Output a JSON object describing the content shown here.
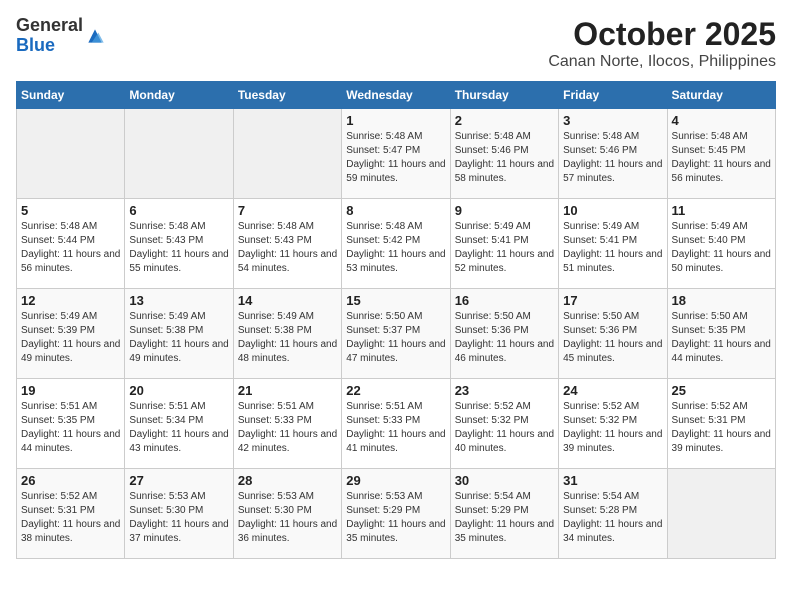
{
  "header": {
    "logo_general": "General",
    "logo_blue": "Blue",
    "month": "October 2025",
    "location": "Canan Norte, Ilocos, Philippines"
  },
  "days_of_week": [
    "Sunday",
    "Monday",
    "Tuesday",
    "Wednesday",
    "Thursday",
    "Friday",
    "Saturday"
  ],
  "weeks": [
    [
      {
        "day": "",
        "sunrise": "",
        "sunset": "",
        "daylight": "",
        "empty": true
      },
      {
        "day": "",
        "sunrise": "",
        "sunset": "",
        "daylight": "",
        "empty": true
      },
      {
        "day": "",
        "sunrise": "",
        "sunset": "",
        "daylight": "",
        "empty": true
      },
      {
        "day": "1",
        "sunrise": "Sunrise: 5:48 AM",
        "sunset": "Sunset: 5:47 PM",
        "daylight": "Daylight: 11 hours and 59 minutes."
      },
      {
        "day": "2",
        "sunrise": "Sunrise: 5:48 AM",
        "sunset": "Sunset: 5:46 PM",
        "daylight": "Daylight: 11 hours and 58 minutes."
      },
      {
        "day": "3",
        "sunrise": "Sunrise: 5:48 AM",
        "sunset": "Sunset: 5:46 PM",
        "daylight": "Daylight: 11 hours and 57 minutes."
      },
      {
        "day": "4",
        "sunrise": "Sunrise: 5:48 AM",
        "sunset": "Sunset: 5:45 PM",
        "daylight": "Daylight: 11 hours and 56 minutes."
      }
    ],
    [
      {
        "day": "5",
        "sunrise": "Sunrise: 5:48 AM",
        "sunset": "Sunset: 5:44 PM",
        "daylight": "Daylight: 11 hours and 56 minutes."
      },
      {
        "day": "6",
        "sunrise": "Sunrise: 5:48 AM",
        "sunset": "Sunset: 5:43 PM",
        "daylight": "Daylight: 11 hours and 55 minutes."
      },
      {
        "day": "7",
        "sunrise": "Sunrise: 5:48 AM",
        "sunset": "Sunset: 5:43 PM",
        "daylight": "Daylight: 11 hours and 54 minutes."
      },
      {
        "day": "8",
        "sunrise": "Sunrise: 5:48 AM",
        "sunset": "Sunset: 5:42 PM",
        "daylight": "Daylight: 11 hours and 53 minutes."
      },
      {
        "day": "9",
        "sunrise": "Sunrise: 5:49 AM",
        "sunset": "Sunset: 5:41 PM",
        "daylight": "Daylight: 11 hours and 52 minutes."
      },
      {
        "day": "10",
        "sunrise": "Sunrise: 5:49 AM",
        "sunset": "Sunset: 5:41 PM",
        "daylight": "Daylight: 11 hours and 51 minutes."
      },
      {
        "day": "11",
        "sunrise": "Sunrise: 5:49 AM",
        "sunset": "Sunset: 5:40 PM",
        "daylight": "Daylight: 11 hours and 50 minutes."
      }
    ],
    [
      {
        "day": "12",
        "sunrise": "Sunrise: 5:49 AM",
        "sunset": "Sunset: 5:39 PM",
        "daylight": "Daylight: 11 hours and 49 minutes."
      },
      {
        "day": "13",
        "sunrise": "Sunrise: 5:49 AM",
        "sunset": "Sunset: 5:38 PM",
        "daylight": "Daylight: 11 hours and 49 minutes."
      },
      {
        "day": "14",
        "sunrise": "Sunrise: 5:49 AM",
        "sunset": "Sunset: 5:38 PM",
        "daylight": "Daylight: 11 hours and 48 minutes."
      },
      {
        "day": "15",
        "sunrise": "Sunrise: 5:50 AM",
        "sunset": "Sunset: 5:37 PM",
        "daylight": "Daylight: 11 hours and 47 minutes."
      },
      {
        "day": "16",
        "sunrise": "Sunrise: 5:50 AM",
        "sunset": "Sunset: 5:36 PM",
        "daylight": "Daylight: 11 hours and 46 minutes."
      },
      {
        "day": "17",
        "sunrise": "Sunrise: 5:50 AM",
        "sunset": "Sunset: 5:36 PM",
        "daylight": "Daylight: 11 hours and 45 minutes."
      },
      {
        "day": "18",
        "sunrise": "Sunrise: 5:50 AM",
        "sunset": "Sunset: 5:35 PM",
        "daylight": "Daylight: 11 hours and 44 minutes."
      }
    ],
    [
      {
        "day": "19",
        "sunrise": "Sunrise: 5:51 AM",
        "sunset": "Sunset: 5:35 PM",
        "daylight": "Daylight: 11 hours and 44 minutes."
      },
      {
        "day": "20",
        "sunrise": "Sunrise: 5:51 AM",
        "sunset": "Sunset: 5:34 PM",
        "daylight": "Daylight: 11 hours and 43 minutes."
      },
      {
        "day": "21",
        "sunrise": "Sunrise: 5:51 AM",
        "sunset": "Sunset: 5:33 PM",
        "daylight": "Daylight: 11 hours and 42 minutes."
      },
      {
        "day": "22",
        "sunrise": "Sunrise: 5:51 AM",
        "sunset": "Sunset: 5:33 PM",
        "daylight": "Daylight: 11 hours and 41 minutes."
      },
      {
        "day": "23",
        "sunrise": "Sunrise: 5:52 AM",
        "sunset": "Sunset: 5:32 PM",
        "daylight": "Daylight: 11 hours and 40 minutes."
      },
      {
        "day": "24",
        "sunrise": "Sunrise: 5:52 AM",
        "sunset": "Sunset: 5:32 PM",
        "daylight": "Daylight: 11 hours and 39 minutes."
      },
      {
        "day": "25",
        "sunrise": "Sunrise: 5:52 AM",
        "sunset": "Sunset: 5:31 PM",
        "daylight": "Daylight: 11 hours and 39 minutes."
      }
    ],
    [
      {
        "day": "26",
        "sunrise": "Sunrise: 5:52 AM",
        "sunset": "Sunset: 5:31 PM",
        "daylight": "Daylight: 11 hours and 38 minutes."
      },
      {
        "day": "27",
        "sunrise": "Sunrise: 5:53 AM",
        "sunset": "Sunset: 5:30 PM",
        "daylight": "Daylight: 11 hours and 37 minutes."
      },
      {
        "day": "28",
        "sunrise": "Sunrise: 5:53 AM",
        "sunset": "Sunset: 5:30 PM",
        "daylight": "Daylight: 11 hours and 36 minutes."
      },
      {
        "day": "29",
        "sunrise": "Sunrise: 5:53 AM",
        "sunset": "Sunset: 5:29 PM",
        "daylight": "Daylight: 11 hours and 35 minutes."
      },
      {
        "day": "30",
        "sunrise": "Sunrise: 5:54 AM",
        "sunset": "Sunset: 5:29 PM",
        "daylight": "Daylight: 11 hours and 35 minutes."
      },
      {
        "day": "31",
        "sunrise": "Sunrise: 5:54 AM",
        "sunset": "Sunset: 5:28 PM",
        "daylight": "Daylight: 11 hours and 34 minutes."
      },
      {
        "day": "",
        "sunrise": "",
        "sunset": "",
        "daylight": "",
        "empty": true
      }
    ]
  ]
}
